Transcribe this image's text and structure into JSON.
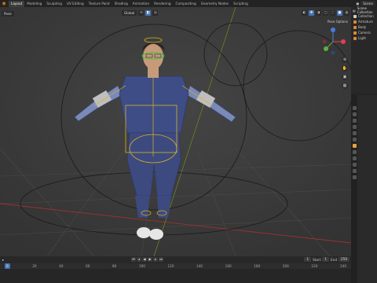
{
  "topbar": {
    "tabs": [
      "Layout",
      "Modeling",
      "Sculpting",
      "UV Editing",
      "Texture Paint",
      "Shading",
      "Animation",
      "Rendering",
      "Compositing",
      "Geometry Nodes",
      "Scripting"
    ],
    "active_tab": "Layout",
    "scene_label": "Scene"
  },
  "viewport": {
    "mode": "Pose",
    "transform_orientation": "Global",
    "pose_options": "Pose Options"
  },
  "timeline": {
    "current_frame": "1",
    "start_label": "Start",
    "start_value": "1",
    "end_label": "End",
    "end_value": "250",
    "ruler_ticks": [
      "0",
      "20",
      "40",
      "60",
      "80",
      "100",
      "120",
      "140",
      "160",
      "180",
      "200",
      "220",
      "240"
    ]
  },
  "outliner": {
    "title": "Scene Collection",
    "items": [
      "Collection",
      "Armature",
      "Body",
      "Camera",
      "Light"
    ]
  },
  "colors": {
    "accent": "#4772b3",
    "bone_yellow": "#d9b41e",
    "bone_green": "#2ecc40",
    "viewport_bg": "#3a3a3a",
    "axis_red": "#a03030"
  }
}
